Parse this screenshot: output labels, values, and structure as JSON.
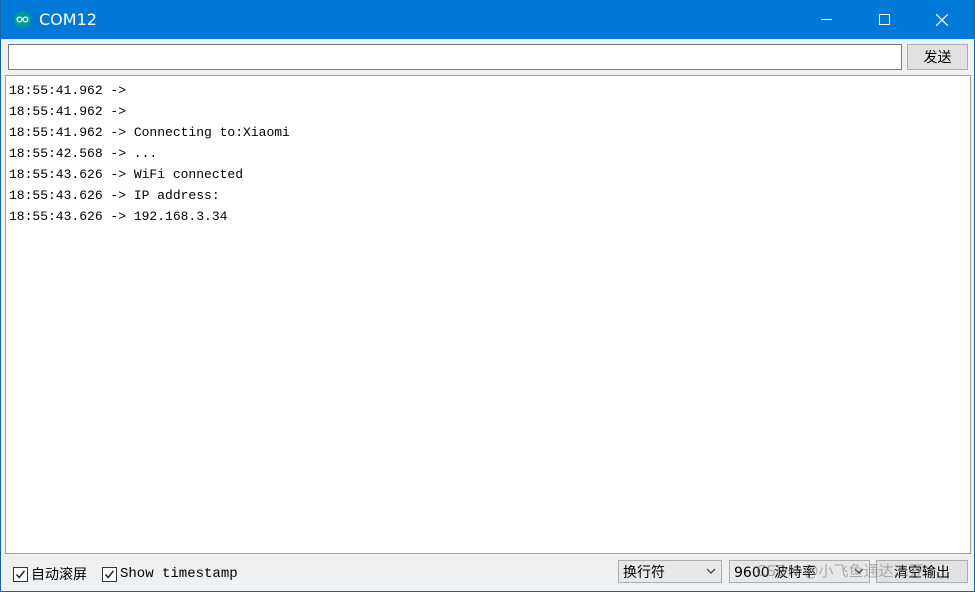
{
  "window": {
    "title": "COM12",
    "icon": "arduino-infinity-icon"
  },
  "toolbar": {
    "send_input_value": "",
    "send_label": "发送"
  },
  "output": {
    "lines": [
      "18:55:41.962 -> ",
      "18:55:41.962 -> ",
      "18:55:41.962 -> Connecting to:Xiaomi",
      "18:55:42.568 -> ...",
      "18:55:43.626 -> WiFi connected",
      "18:55:43.626 -> IP address: ",
      "18:55:43.626 -> 192.168.3.34"
    ]
  },
  "status": {
    "autoscroll_label": "自动滚屏",
    "autoscroll_checked": true,
    "timestamp_label": "Show timestamp",
    "timestamp_checked": true,
    "line_ending_value": "换行符",
    "baud_value": "9600 波特率",
    "clear_label": "清空输出"
  },
  "watermark": "CSDN @小飞鱼通达二开",
  "colors": {
    "titlebar": "#0078d7",
    "arduino_teal": "#00979d"
  }
}
